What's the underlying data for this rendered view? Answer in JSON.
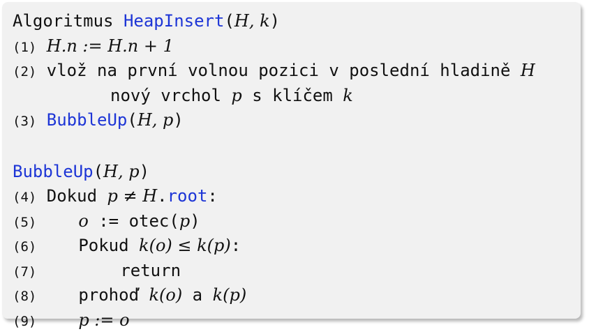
{
  "algo1": {
    "prefix": "Algoritmus ",
    "name": "HeapInsert",
    "args_open": "(",
    "args": "H, k",
    "args_close": ")"
  },
  "lines": {
    "l1_num": "(1)",
    "l1_math": "H.n := H.n + 1",
    "l2_num": "(2)",
    "l2_text": "vlož na první volnou pozici v poslední hladině",
    "l2_math": "H",
    "l2b_text1": "nový vrchol",
    "l2b_math1": "p",
    "l2b_text2": "s klíčem",
    "l2b_math2": "k",
    "l3_num": "(3)",
    "l3_call": "BubbleUp",
    "l3_open": "(",
    "l3_args": "H, p",
    "l3_close": ")"
  },
  "algo2": {
    "name": "BubbleUp",
    "args_open": "(",
    "args": "H, p",
    "args_close": ")"
  },
  "body": {
    "l4_num": "(4)",
    "l4_text": "Dokud",
    "l4_math": "p ≠ H",
    "l4_dot": ".",
    "l4_root": "root",
    "l4_colon": ":",
    "l5_num": "(5)",
    "l5_math": "o",
    "l5_text": ":= otec(",
    "l5_arg": "p",
    "l5_close": ")",
    "l6_num": "(6)",
    "l6_text": "Pokud",
    "l6_math": "k(o) ≤ k(p)",
    "l6_colon": ":",
    "l7_num": "(7)",
    "l7_text": "return",
    "l8_num": "(8)",
    "l8_text": "prohoď",
    "l8_math1": "k(o)",
    "l8_and": "a",
    "l8_math2": "k(p)",
    "l9_num": "(9)",
    "l9_math": "p := o"
  }
}
